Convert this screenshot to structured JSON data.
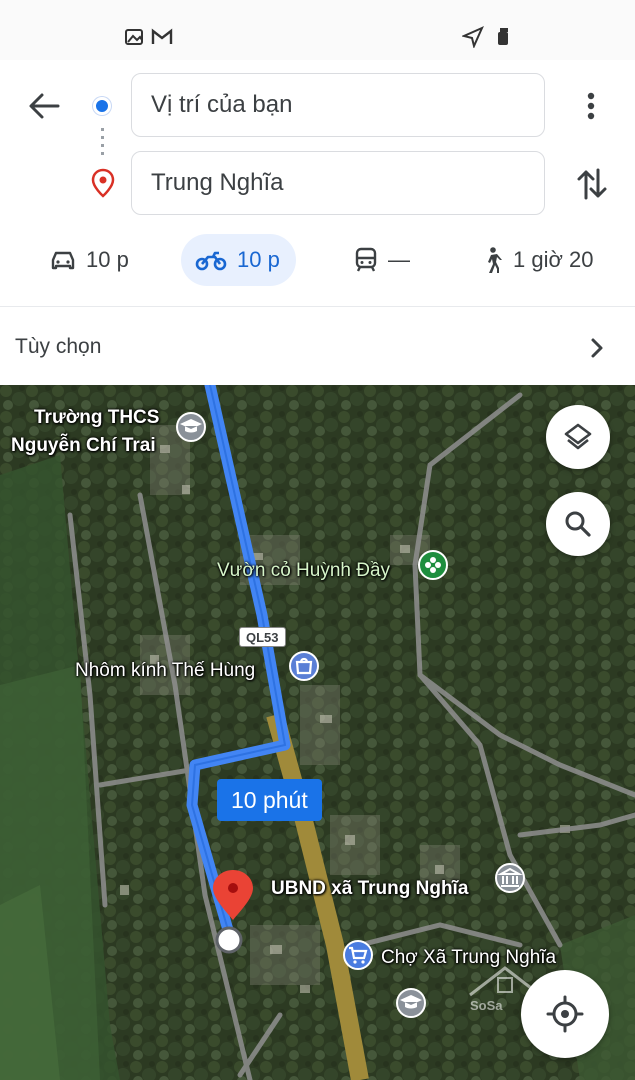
{
  "status_bar": {
    "left_icons": [
      "gallery-icon",
      "gmail-icon"
    ],
    "right_icons": [
      "location-arrow-icon",
      "cleaner-icon"
    ]
  },
  "directions": {
    "origin": "Vị trí của bạn",
    "destination": "Trung Nghĩa"
  },
  "modes": [
    {
      "name": "car",
      "label": "10 p",
      "icon": "car-icon"
    },
    {
      "name": "motorbike",
      "label": "10 p",
      "icon": "motorbike-icon",
      "active": true
    },
    {
      "name": "transit",
      "label": "—",
      "icon": "transit-icon"
    },
    {
      "name": "walk",
      "label": "1 giờ 20",
      "icon": "walk-icon"
    }
  ],
  "options": {
    "label": "Tùy chọn"
  },
  "map": {
    "labels": {
      "school_1_line1": "Trường THCS",
      "school_1_line2": "Nguyễn Chí Trai",
      "garden": "Vườn cỏ Huỳnh Đầy",
      "road_shield": "QL53",
      "shop": "Nhôm kính Thế Hùng",
      "route_time": "10 phút",
      "office": "UBND xã Trung Nghĩa",
      "market": "Chợ Xã Trung Nghĩa",
      "watermark": "SoSa"
    },
    "colors": {
      "route": "#4285f4",
      "highway": "#a08a3a",
      "pin": "#ea4335"
    }
  }
}
